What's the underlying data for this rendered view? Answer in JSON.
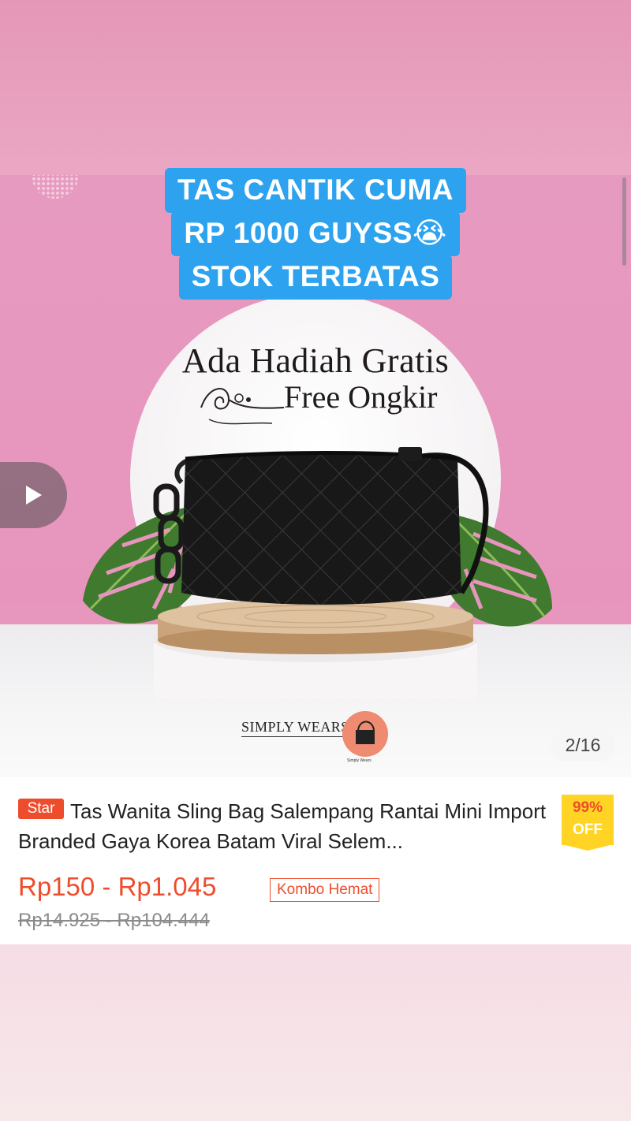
{
  "overlay": {
    "headline_lines": [
      "TAS CANTIK CUMA",
      "RP 1000 GUYSS😭",
      "STOK TERBATAS"
    ]
  },
  "product_image": {
    "promo_line1": "Ada Hadiah Gratis",
    "promo_line2": "Free Ongkir",
    "brand_name": "SIMPLY WEARS",
    "brand_sub": "Simply Wears",
    "page_counter": "2/16"
  },
  "product": {
    "badge": "Star",
    "title": "Tas Wanita Sling Bag Salempang Rantai Mini Import Branded Gaya Korea Batam Viral Selem...",
    "discount_percent": "99%",
    "discount_off": "OFF",
    "price_range": "Rp150 - Rp1.045",
    "combo_tag": "Kombo Hemat",
    "original_price_range": "Rp14.925 - Rp104.444"
  },
  "colors": {
    "accent": "#ee4d2d",
    "headline_bg": "#2da3f0",
    "discount_bg": "#ffd424",
    "background_pink": "#e79ac0"
  },
  "icons": [
    "play-icon"
  ]
}
